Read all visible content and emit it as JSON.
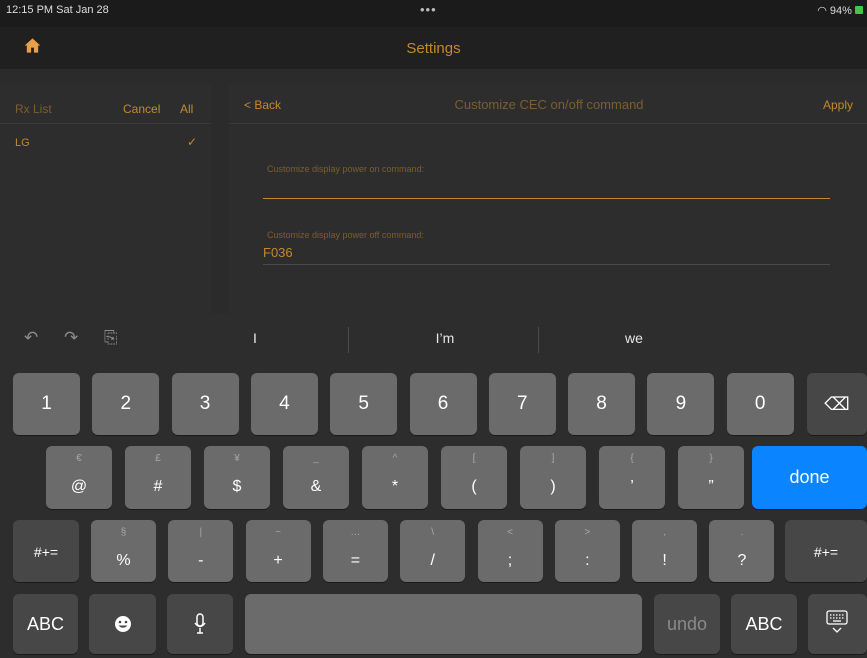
{
  "status": {
    "time": "12:15 PM  Sat Jan 28",
    "dots": "•••",
    "battery": "94%"
  },
  "nav": {
    "title": "Settings"
  },
  "left_panel": {
    "header": "Rx List",
    "cancel": "Cancel",
    "all": "All",
    "items": [
      {
        "label": "LG",
        "check": "✓"
      }
    ]
  },
  "right_panel": {
    "back": "< Back",
    "title": "Customize CEC on/off command",
    "apply": "Apply",
    "power_on": {
      "label": "Customize display power on command:",
      "value": ""
    },
    "power_off": {
      "label": "Customize display power off command:",
      "value": "F036"
    }
  },
  "keyboard": {
    "suggestions": [
      "I",
      "I’m",
      "we"
    ],
    "tools": {
      "undo": "↶",
      "redo": "↷",
      "paste": "⎘"
    },
    "row1": [
      "1",
      "2",
      "3",
      "4",
      "5",
      "6",
      "7",
      "8",
      "9",
      "0"
    ],
    "row2": [
      {
        "main": "@",
        "alt": "€"
      },
      {
        "main": "#",
        "alt": "£"
      },
      {
        "main": "$",
        "alt": "¥"
      },
      {
        "main": "&",
        "alt": "_"
      },
      {
        "main": "*",
        "alt": "^"
      },
      {
        "main": "(",
        "alt": "["
      },
      {
        "main": ")",
        "alt": "]"
      },
      {
        "main": "’",
        "alt": "{"
      },
      {
        "main": "”",
        "alt": "}"
      }
    ],
    "row3": [
      {
        "main": "%",
        "alt": "§"
      },
      {
        "main": "-",
        "alt": "|"
      },
      {
        "main": "+",
        "alt": "~"
      },
      {
        "main": "=",
        "alt": "…"
      },
      {
        "main": "/",
        "alt": "\\"
      },
      {
        "main": ";",
        "alt": "<"
      },
      {
        "main": ":",
        "alt": ">"
      },
      {
        "main": "!",
        "alt": ","
      },
      {
        "main": "?",
        "alt": "."
      }
    ],
    "shift_label": "#+=",
    "done": "done",
    "abc": "ABC",
    "undo": "undo",
    "delete_icon": "⌫"
  }
}
